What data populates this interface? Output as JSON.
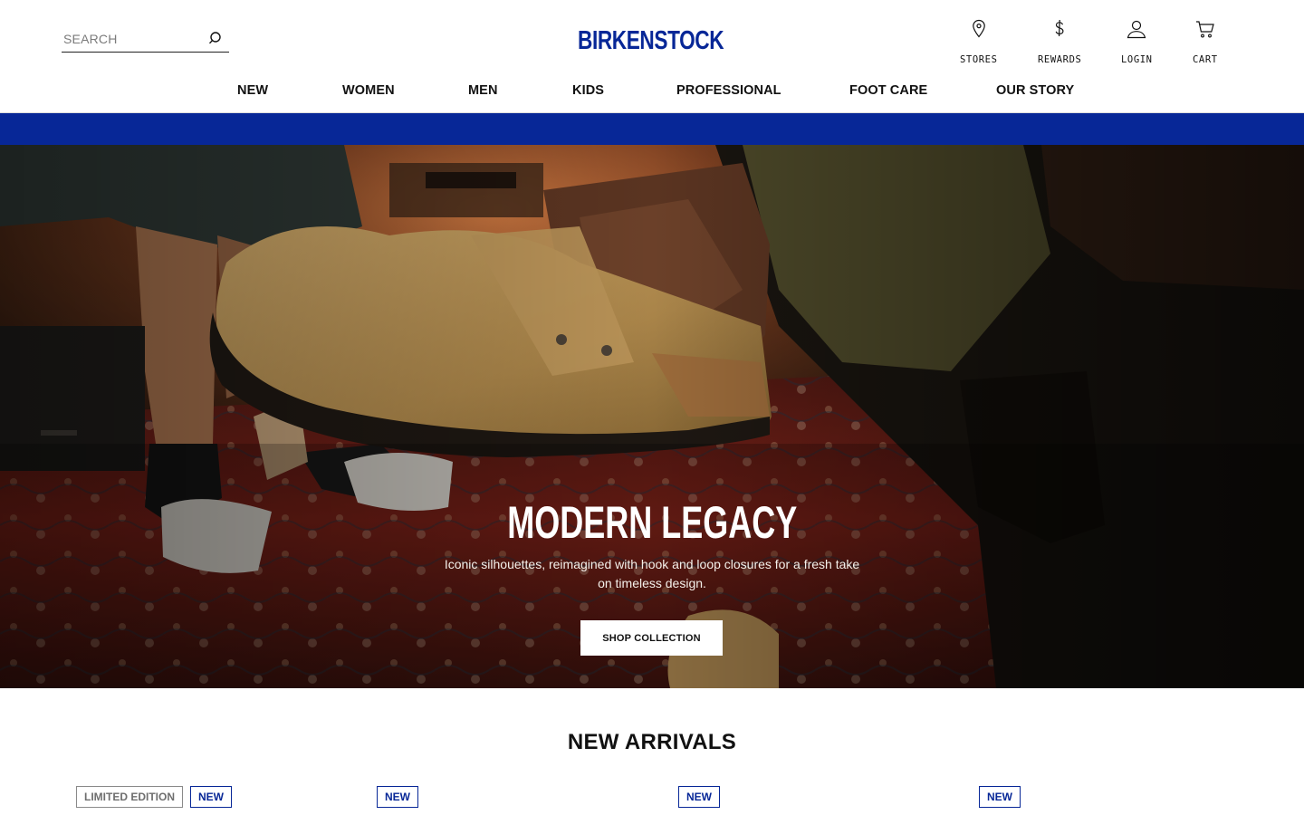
{
  "search": {
    "placeholder": "SEARCH",
    "icon": "search-icon"
  },
  "brand": {
    "logo_text": "BIRKENSTOCK",
    "color": "#072797"
  },
  "utility_nav": [
    {
      "label": "STORES",
      "icon": "map-pin-icon"
    },
    {
      "label": "REWARDS",
      "icon": "dollar-icon"
    },
    {
      "label": "LOGIN",
      "icon": "user-icon"
    },
    {
      "label": "CART",
      "icon": "cart-icon"
    }
  ],
  "main_nav": [
    "NEW",
    "WOMEN",
    "MEN",
    "KIDS",
    "PROFESSIONAL",
    "FOOT CARE",
    "OUR STORY"
  ],
  "promo_bar": {
    "color": "#072797"
  },
  "hero": {
    "title": "MODERN LEGACY",
    "subtitle": "Iconic silhouettes, reimagined with hook and loop closures for a fresh take on timeless design.",
    "cta": "SHOP COLLECTION",
    "image_description_icon": "hero-image"
  },
  "new_arrivals": {
    "title": "NEW ARRIVALS",
    "products": [
      {
        "badges": [
          "LIMITED EDITION",
          "NEW"
        ]
      },
      {
        "badges": [
          "NEW"
        ]
      },
      {
        "badges": [
          "NEW"
        ]
      },
      {
        "badges": [
          "NEW"
        ]
      }
    ]
  }
}
